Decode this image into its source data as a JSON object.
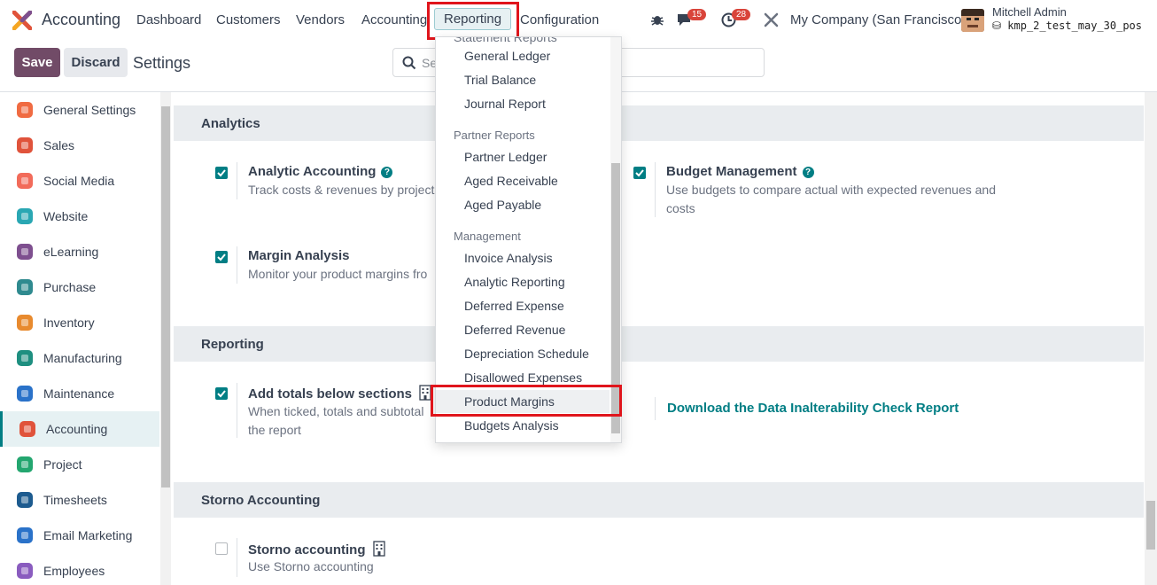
{
  "navbar": {
    "app_name": "Accounting",
    "menu": [
      "Dashboard",
      "Customers",
      "Vendors",
      "Accounting",
      "Reporting",
      "Configuration"
    ],
    "messages_count": "15",
    "activities_count": "28",
    "company": "My Company (San Francisco)",
    "user_name": "Mitchell Admin",
    "user_db": "kmp_2_test_may_30_pos"
  },
  "control_panel": {
    "save_label": "Save",
    "discard_label": "Discard",
    "breadcrumb": "Settings",
    "search_placeholder": "Se"
  },
  "sidebar": {
    "items": [
      {
        "label": "General Settings",
        "icon": "general-settings-icon",
        "color": "#f06b42"
      },
      {
        "label": "Sales",
        "icon": "sales-icon",
        "color": "#e0533b"
      },
      {
        "label": "Social Media",
        "icon": "social-media-icon",
        "color": "#f26b5a"
      },
      {
        "label": "Website",
        "icon": "website-icon",
        "color": "#2aa7b3"
      },
      {
        "label": "eLearning",
        "icon": "elearning-icon",
        "color": "#7e4f8f"
      },
      {
        "label": "Purchase",
        "icon": "purchase-icon",
        "color": "#2f8a8f"
      },
      {
        "label": "Inventory",
        "icon": "inventory-icon",
        "color": "#e88a2e"
      },
      {
        "label": "Manufacturing",
        "icon": "manufacturing-icon",
        "color": "#1e8f80"
      },
      {
        "label": "Maintenance",
        "icon": "maintenance-icon",
        "color": "#2a72c9"
      },
      {
        "label": "Accounting",
        "icon": "accounting-icon",
        "color": "#e0533b"
      },
      {
        "label": "Project",
        "icon": "project-icon",
        "color": "#23a66f"
      },
      {
        "label": "Timesheets",
        "icon": "timesheets-icon",
        "color": "#1d5b8f"
      },
      {
        "label": "Email Marketing",
        "icon": "email-marketing-icon",
        "color": "#2a72c9"
      },
      {
        "label": "Employees",
        "icon": "employees-icon",
        "color": "#8a5cbf"
      }
    ],
    "active": "Accounting"
  },
  "sections": {
    "analytics": {
      "title": "Analytics",
      "analytic_accounting": {
        "title": "Analytic Accounting",
        "desc": "Track costs & revenues by project",
        "checked": true
      },
      "budget_management": {
        "title": "Budget Management",
        "desc_1": "Use budgets to compare actual with expected revenues and",
        "desc_2": "costs",
        "checked": true
      },
      "margin_analysis": {
        "title": "Margin Analysis",
        "desc": "Monitor your product margins fro",
        "checked": true
      }
    },
    "reporting": {
      "title": "Reporting",
      "add_totals": {
        "title": "Add totals below sections",
        "desc_1": "When ticked, totals and subtotal",
        "desc_2": "the report",
        "checked": true
      },
      "download_link": "Download the Data Inalterability Check Report"
    },
    "storno": {
      "title": "Storno Accounting",
      "storno_accounting": {
        "title": "Storno accounting",
        "desc": "Use Storno accounting",
        "checked": false
      }
    }
  },
  "dropdown": {
    "cut_header": "Statement Reports",
    "group_top_items": [
      "General Ledger",
      "Trial Balance",
      "Journal Report"
    ],
    "partner_header": "Partner Reports",
    "partner_items": [
      "Partner Ledger",
      "Aged Receivable",
      "Aged Payable"
    ],
    "management_header": "Management",
    "management_items": [
      "Invoice Analysis",
      "Analytic Reporting",
      "Deferred Expense",
      "Deferred Revenue",
      "Depreciation Schedule",
      "Disallowed Expenses",
      "Product Margins",
      "Budgets Analysis"
    ],
    "highlighted": "Product Margins"
  },
  "colors": {
    "brand": "#714b67",
    "accent": "#017e84",
    "highlight": "#e0151c"
  }
}
